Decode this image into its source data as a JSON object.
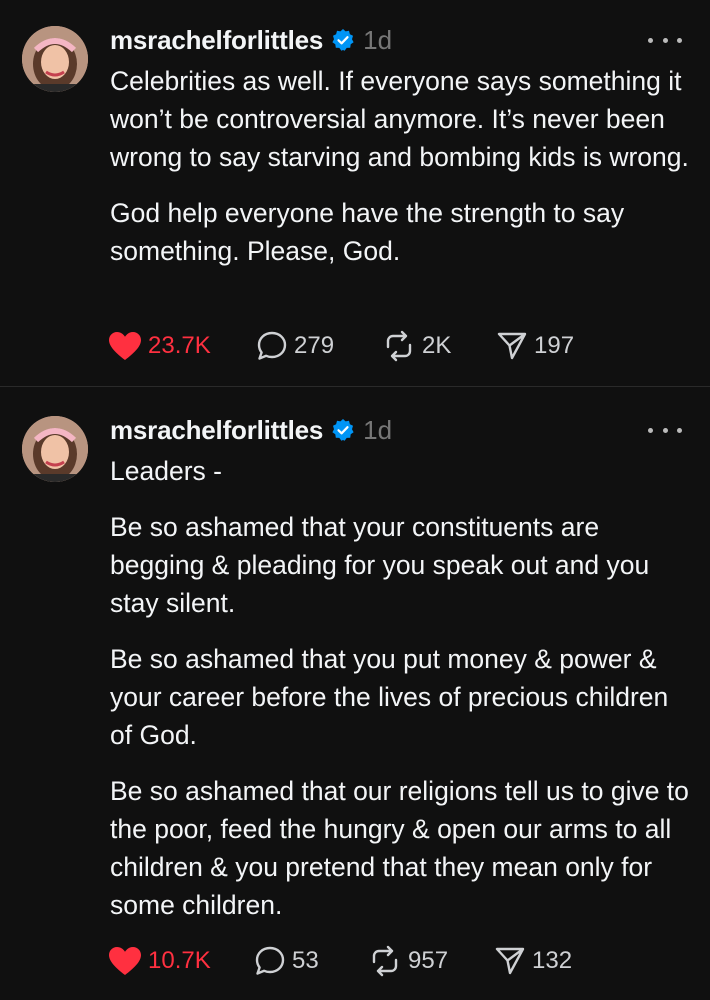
{
  "posts": [
    {
      "username": "msrachelforlittles",
      "time": "1d",
      "paragraphs": [
        "Celebrities as well. If everyone says something it won’t be controversial anymore. It’s never been wrong to say starving and bombing kids is wrong.",
        "God help everyone have the strength to say something. Please, God."
      ],
      "likes": "23.7K",
      "comments": "279",
      "reposts": "2K",
      "shares": "197"
    },
    {
      "username": "msrachelforlittles",
      "time": "1d",
      "paragraphs": [
        "Leaders -",
        "Be so ashamed that your constituents are begging & pleading for you speak out and you stay silent.",
        "Be so ashamed that you put money & power & your career before the lives of precious children of God.",
        "Be so ashamed that our religions tell us to give to the poor, feed the hungry & open our arms to all children & you pretend that they mean only for some children."
      ],
      "likes": "10.7K",
      "comments": "53",
      "reposts": "957",
      "shares": "132"
    }
  ],
  "colors": {
    "background": "#101010",
    "like": "#ff3040",
    "verified": "#0095f6",
    "muted": "#777777"
  },
  "icons": {
    "verified": "verified-badge-icon",
    "more": "more-dots-icon",
    "like": "heart-icon",
    "comment": "comment-bubble-icon",
    "repost": "repost-icon",
    "share": "share-paper-plane-icon"
  }
}
